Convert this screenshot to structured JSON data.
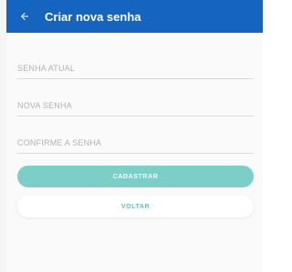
{
  "header": {
    "title": "Criar nova senha",
    "back_icon": "arrow-left-icon"
  },
  "form": {
    "current_password_placeholder": "SENHA ATUAL",
    "new_password_placeholder": "NOVA SENHA",
    "confirm_password_placeholder": "CONFIRME A SENHA"
  },
  "actions": {
    "submit_label": "CADASTRAR",
    "back_label": "VOLTAR"
  },
  "colors": {
    "appbar": "#1565c0",
    "primary_button": "#7ccfc6",
    "secondary_text": "#66c2b8"
  }
}
